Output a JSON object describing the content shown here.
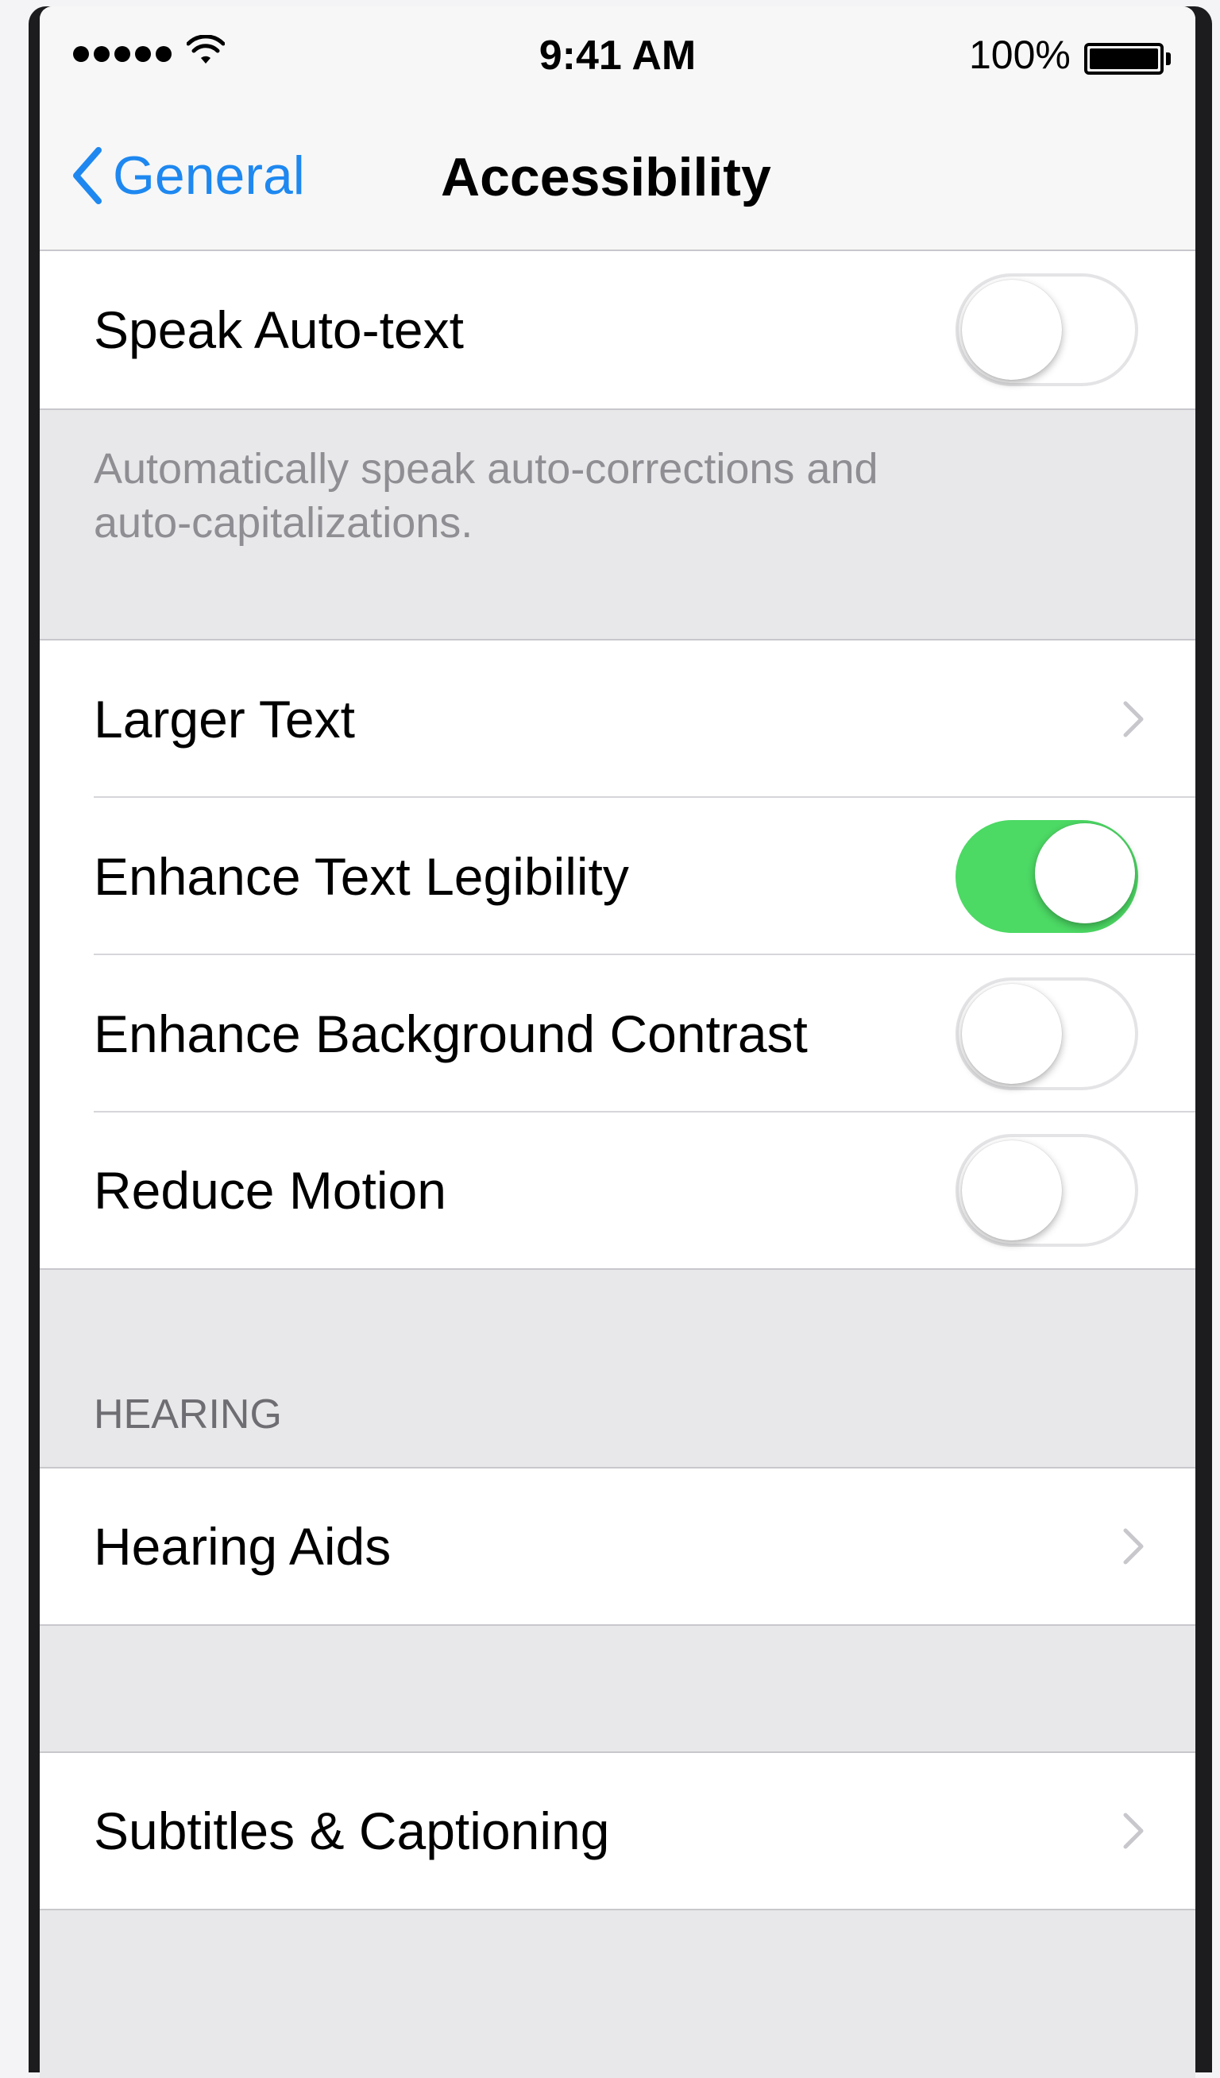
{
  "status_bar": {
    "signal_dots": 5,
    "time": "9:41 AM",
    "battery_percent": "100%",
    "battery_level": 1.0
  },
  "nav": {
    "back_label": "General",
    "title": "Accessibility"
  },
  "rows_top": [
    {
      "label": "Speak Auto-text",
      "type": "toggle",
      "on": false
    }
  ],
  "speak_footer": "Automatically speak auto-corrections and auto-capitalizations.",
  "rows_display": [
    {
      "label": "Larger Text",
      "type": "disclosure"
    },
    {
      "label": "Enhance Text Legibility",
      "type": "toggle",
      "on": true
    },
    {
      "label": "Enhance Background Contrast",
      "type": "toggle",
      "on": false
    },
    {
      "label": "Reduce Motion",
      "type": "toggle",
      "on": false
    }
  ],
  "hearing": {
    "header": "HEARING",
    "rows": [
      {
        "label": "Hearing Aids",
        "type": "disclosure"
      }
    ]
  },
  "rows_media": [
    {
      "label": "Subtitles & Captioning",
      "type": "disclosure"
    }
  ],
  "colors": {
    "accent_blue": "#1e88f0",
    "toggle_on_green": "#4cd964",
    "group_background": "#e8e8ea",
    "footer_text": "#8e8e93"
  }
}
